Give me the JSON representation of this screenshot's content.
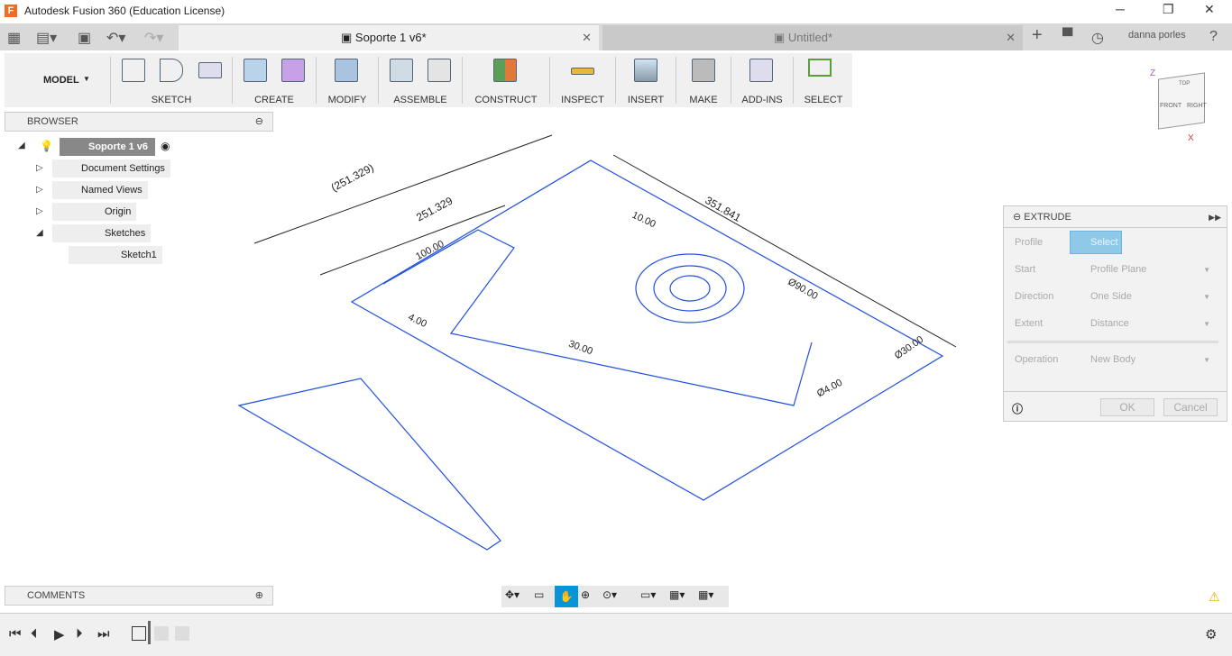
{
  "window": {
    "title": "Autodesk Fusion 360 (Education License)",
    "logo": "F"
  },
  "tabs": [
    {
      "label": "Soporte 1 v6*",
      "active": true
    },
    {
      "label": "Untitled*",
      "active": false
    }
  ],
  "user": {
    "name": "danna porles"
  },
  "toolbar": {
    "workspace": "MODEL",
    "groups": [
      "SKETCH",
      "CREATE",
      "MODIFY",
      "ASSEMBLE",
      "CONSTRUCT",
      "INSPECT",
      "INSERT",
      "MAKE",
      "ADD-INS",
      "SELECT"
    ]
  },
  "viewcube": {
    "top": "TOP",
    "front": "FRONT",
    "right": "RIGHT",
    "z": "Z",
    "x": "X"
  },
  "browser": {
    "title": "BROWSER",
    "root": "Soporte 1 v6",
    "items": [
      "Document Settings",
      "Named Views",
      "Origin",
      "Sketches"
    ],
    "sketch": "Sketch1"
  },
  "canvas": {
    "dims": [
      "(251.329)",
      "251.329",
      "351.841",
      "100.00",
      "Ø90.00",
      "Ø4.00",
      "30.00",
      "4.00",
      "10.00",
      "Ø30.00"
    ]
  },
  "extrude": {
    "title": "EXTRUDE",
    "profile_label": "Profile",
    "profile_value": "Select",
    "start_label": "Start",
    "start_value": "Profile Plane",
    "direction_label": "Direction",
    "direction_value": "One Side",
    "extent_label": "Extent",
    "extent_value": "Distance",
    "operation_label": "Operation",
    "operation_value": "New Body",
    "ok": "OK",
    "cancel": "Cancel"
  },
  "comments": {
    "title": "COMMENTS"
  },
  "colors": {
    "sketch": "#1f4fe0",
    "accent": "#0696d7",
    "select_btn": "#8ecae8"
  }
}
